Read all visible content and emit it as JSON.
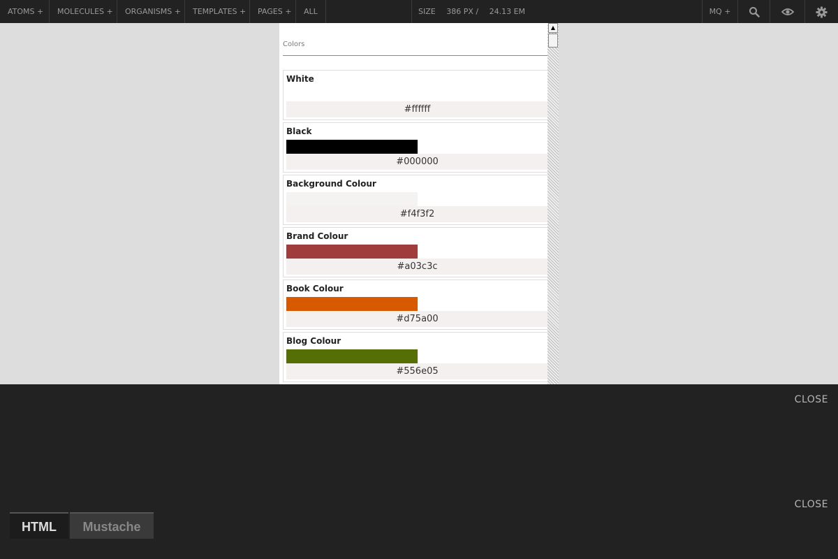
{
  "nav": {
    "items": [
      "ATOMS +",
      "MOLECULES +",
      "ORGANISMS +",
      "TEMPLATES +",
      "PAGES +",
      "ALL"
    ],
    "size_label": "SIZE",
    "size_px": "386 PX /",
    "size_em": "24.13 EM",
    "mq_label": "MQ +",
    "icons": [
      "search-icon",
      "eye-icon",
      "gear-icon"
    ]
  },
  "viewport": {
    "section_title": "Colors",
    "swatches": [
      {
        "name": "White",
        "hex": "#ffffff"
      },
      {
        "name": "Black",
        "hex": "#000000"
      },
      {
        "name": "Background Colour",
        "hex": "#f4f3f2"
      },
      {
        "name": "Brand Colour",
        "hex": "#a03c3c"
      },
      {
        "name": "Book Colour",
        "hex": "#d75a00"
      },
      {
        "name": "Blog Colour",
        "hex": "#556e05"
      }
    ]
  },
  "codepanel": {
    "close_label": "CLOSE",
    "close_label_2": "CLOSE",
    "tabs": [
      {
        "label": "HTML",
        "active": true
      },
      {
        "label": "Mustache",
        "active": false
      }
    ]
  }
}
